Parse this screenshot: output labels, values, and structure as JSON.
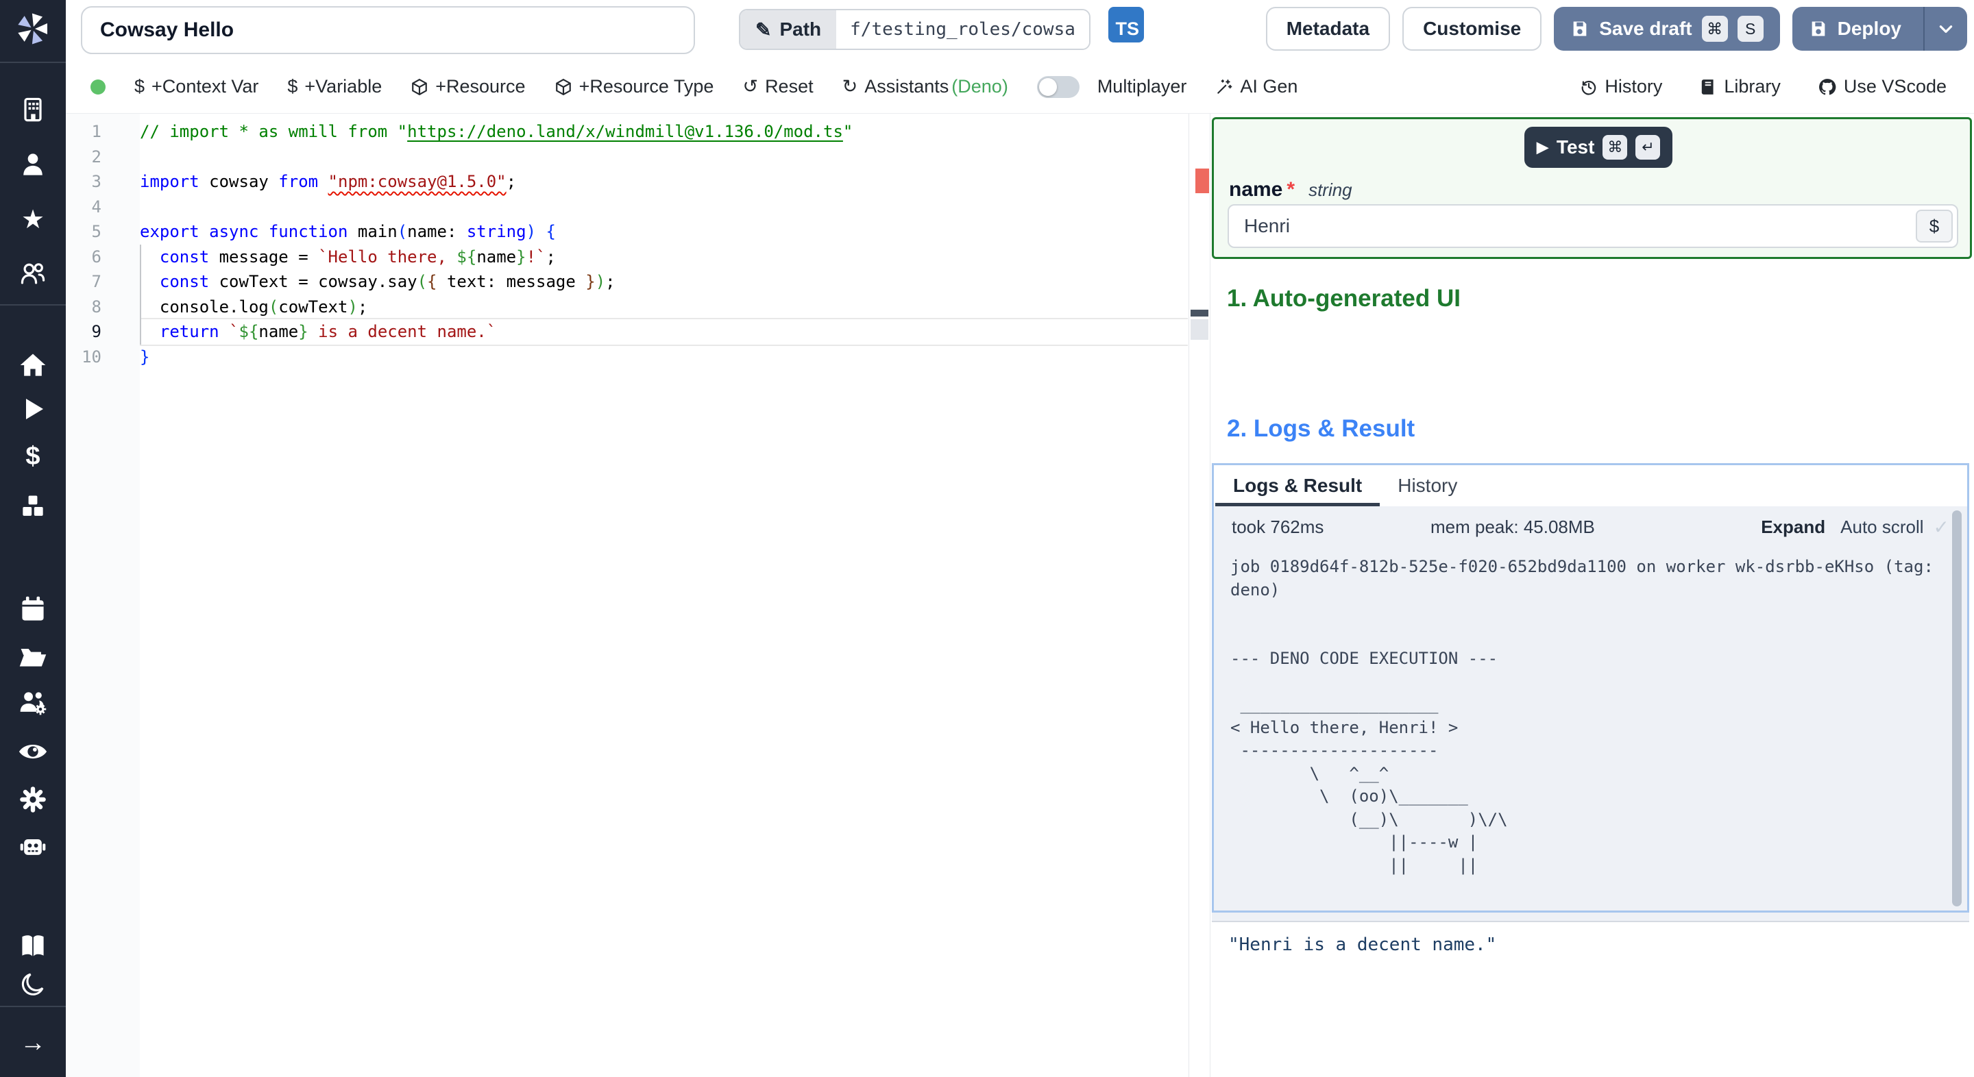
{
  "topbar": {
    "title_value": "Cowsay Hello",
    "path_label": "Path",
    "path_value": "f/testing_roles/cowsa",
    "lang_badge": "TS",
    "metadata_label": "Metadata",
    "customise_label": "Customise",
    "save_draft_label": "Save draft",
    "save_shortcut_mod": "⌘",
    "save_shortcut_key": "S",
    "deploy_label": "Deploy"
  },
  "toolbar": {
    "context_var": "+Context Var",
    "variable": "+Variable",
    "resource": "+Resource",
    "resource_type": "+Resource Type",
    "reset": "Reset",
    "assistants_prefix": "Assistants ",
    "assistants_lang": "(Deno)",
    "multiplayer": "Multiplayer",
    "ai_gen": "AI Gen",
    "history": "History",
    "library": "Library",
    "use_vscode": "Use VScode"
  },
  "sidebar": {
    "icons": [
      "windmill-logo",
      "workspace-icon",
      "user-icon",
      "favorites-star-icon",
      "users-icon",
      "home-icon",
      "runs-play-icon",
      "variables-dollar-icon",
      "resources-cubes-icon",
      "schedules-calendar-icon",
      "folders-icon",
      "groups-gear-icon",
      "audit-logs-eye-icon",
      "settings-gear-icon",
      "workers-robot-icon",
      "docs-book-icon",
      "dark-mode-moon-icon",
      "collapse-arrow-icon"
    ]
  },
  "editor": {
    "lines": [
      {
        "n": "1",
        "tokens": [
          [
            "c",
            "// import * as wmill from \""
          ],
          [
            "cl",
            "https://deno.land/x/windmill@v1.136.0/mod.ts"
          ],
          [
            "c",
            "\""
          ]
        ]
      },
      {
        "n": "2",
        "tokens": []
      },
      {
        "n": "3",
        "tokens": [
          [
            "k",
            "import"
          ],
          [
            "p",
            " cowsay "
          ],
          [
            "k",
            "from"
          ],
          [
            "p",
            " "
          ],
          [
            "se",
            "\"npm:cowsay@1.5.0\""
          ],
          [
            "p",
            ";"
          ]
        ]
      },
      {
        "n": "4",
        "tokens": []
      },
      {
        "n": "5",
        "tokens": [
          [
            "k",
            "export"
          ],
          [
            "p",
            " "
          ],
          [
            "k",
            "async"
          ],
          [
            "p",
            " "
          ],
          [
            "k",
            "function"
          ],
          [
            "p",
            " main"
          ],
          [
            "b1",
            "("
          ],
          [
            "p",
            "name: "
          ],
          [
            "k",
            "string"
          ],
          [
            "b1",
            ")"
          ],
          [
            "p",
            " "
          ],
          [
            "b1",
            "{"
          ]
        ]
      },
      {
        "n": "6",
        "tokens": [
          [
            "p",
            "  "
          ],
          [
            "k",
            "const"
          ],
          [
            "p",
            " message = "
          ],
          [
            "s",
            "`Hello there, "
          ],
          [
            "b2",
            "${"
          ],
          [
            "p",
            "name"
          ],
          [
            "b2",
            "}"
          ],
          [
            "s",
            "!`"
          ],
          [
            "p",
            ";"
          ]
        ]
      },
      {
        "n": "7",
        "tokens": [
          [
            "p",
            "  "
          ],
          [
            "k",
            "const"
          ],
          [
            "p",
            " cowText = cowsay.say"
          ],
          [
            "b2",
            "("
          ],
          [
            "b3",
            "{"
          ],
          [
            "p",
            " text: message "
          ],
          [
            "b3",
            "}"
          ],
          [
            "b2",
            ")"
          ],
          [
            "p",
            ";"
          ]
        ]
      },
      {
        "n": "8",
        "tokens": [
          [
            "p",
            "  console.log"
          ],
          [
            "b2",
            "("
          ],
          [
            "p",
            "cowText"
          ],
          [
            "b2",
            ")"
          ],
          [
            "p",
            ";"
          ]
        ]
      },
      {
        "n": "9",
        "active": true,
        "tokens": [
          [
            "p",
            "  "
          ],
          [
            "k",
            "return"
          ],
          [
            "p",
            " "
          ],
          [
            "s",
            "`"
          ],
          [
            "b2",
            "${"
          ],
          [
            "p",
            "name"
          ],
          [
            "b2",
            "}"
          ],
          [
            "s",
            " is a decent name.`"
          ]
        ]
      },
      {
        "n": "10",
        "tokens": [
          [
            "b1",
            "}"
          ]
        ]
      }
    ]
  },
  "run_panel": {
    "test_label": "Test",
    "test_shortcut_mod": "⌘",
    "test_shortcut_key": "↵",
    "arg_name": "name",
    "arg_required": "*",
    "arg_type": "string",
    "arg_value": "Henri",
    "pin_button": "$",
    "section_1": "1. Auto-generated UI",
    "section_2": "2. Logs & Result",
    "tab_logs": "Logs & Result",
    "tab_history": "History",
    "took": "took 762ms",
    "mem_peak": "mem peak: 45.08MB",
    "expand": "Expand",
    "autoscroll": "Auto scroll",
    "check": "✓",
    "log": "job 0189d64f-812b-525e-f020-652bd9da1100 on worker wk-dsrbb-eKHso (tag:\ndeno)\n\n\n--- DENO CODE EXECUTION ---\n\n ____________________\n< Hello there, Henri! >\n --------------------\n        \\   ^__^\n         \\  (oo)\\_______\n            (__)\\       )\\/\\\n                ||----w |\n                ||     ||",
    "result": "\"Henri is a decent name.\""
  }
}
